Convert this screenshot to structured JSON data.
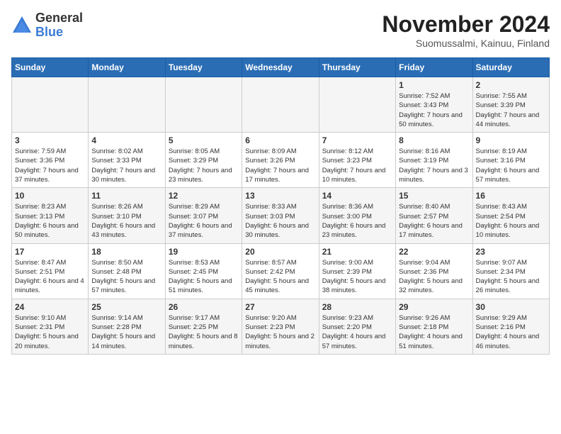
{
  "header": {
    "logo_general": "General",
    "logo_blue": "Blue",
    "month_title": "November 2024",
    "location": "Suomussalmi, Kainuu, Finland"
  },
  "weekdays": [
    "Sunday",
    "Monday",
    "Tuesday",
    "Wednesday",
    "Thursday",
    "Friday",
    "Saturday"
  ],
  "weeks": [
    [
      {
        "day": "",
        "info": ""
      },
      {
        "day": "",
        "info": ""
      },
      {
        "day": "",
        "info": ""
      },
      {
        "day": "",
        "info": ""
      },
      {
        "day": "",
        "info": ""
      },
      {
        "day": "1",
        "info": "Sunrise: 7:52 AM\nSunset: 3:43 PM\nDaylight: 7 hours\nand 50 minutes."
      },
      {
        "day": "2",
        "info": "Sunrise: 7:55 AM\nSunset: 3:39 PM\nDaylight: 7 hours\nand 44 minutes."
      }
    ],
    [
      {
        "day": "3",
        "info": "Sunrise: 7:59 AM\nSunset: 3:36 PM\nDaylight: 7 hours\nand 37 minutes."
      },
      {
        "day": "4",
        "info": "Sunrise: 8:02 AM\nSunset: 3:33 PM\nDaylight: 7 hours\nand 30 minutes."
      },
      {
        "day": "5",
        "info": "Sunrise: 8:05 AM\nSunset: 3:29 PM\nDaylight: 7 hours\nand 23 minutes."
      },
      {
        "day": "6",
        "info": "Sunrise: 8:09 AM\nSunset: 3:26 PM\nDaylight: 7 hours\nand 17 minutes."
      },
      {
        "day": "7",
        "info": "Sunrise: 8:12 AM\nSunset: 3:23 PM\nDaylight: 7 hours\nand 10 minutes."
      },
      {
        "day": "8",
        "info": "Sunrise: 8:16 AM\nSunset: 3:19 PM\nDaylight: 7 hours\nand 3 minutes."
      },
      {
        "day": "9",
        "info": "Sunrise: 8:19 AM\nSunset: 3:16 PM\nDaylight: 6 hours\nand 57 minutes."
      }
    ],
    [
      {
        "day": "10",
        "info": "Sunrise: 8:23 AM\nSunset: 3:13 PM\nDaylight: 6 hours\nand 50 minutes."
      },
      {
        "day": "11",
        "info": "Sunrise: 8:26 AM\nSunset: 3:10 PM\nDaylight: 6 hours\nand 43 minutes."
      },
      {
        "day": "12",
        "info": "Sunrise: 8:29 AM\nSunset: 3:07 PM\nDaylight: 6 hours\nand 37 minutes."
      },
      {
        "day": "13",
        "info": "Sunrise: 8:33 AM\nSunset: 3:03 PM\nDaylight: 6 hours\nand 30 minutes."
      },
      {
        "day": "14",
        "info": "Sunrise: 8:36 AM\nSunset: 3:00 PM\nDaylight: 6 hours\nand 23 minutes."
      },
      {
        "day": "15",
        "info": "Sunrise: 8:40 AM\nSunset: 2:57 PM\nDaylight: 6 hours\nand 17 minutes."
      },
      {
        "day": "16",
        "info": "Sunrise: 8:43 AM\nSunset: 2:54 PM\nDaylight: 6 hours\nand 10 minutes."
      }
    ],
    [
      {
        "day": "17",
        "info": "Sunrise: 8:47 AM\nSunset: 2:51 PM\nDaylight: 6 hours\nand 4 minutes."
      },
      {
        "day": "18",
        "info": "Sunrise: 8:50 AM\nSunset: 2:48 PM\nDaylight: 5 hours\nand 57 minutes."
      },
      {
        "day": "19",
        "info": "Sunrise: 8:53 AM\nSunset: 2:45 PM\nDaylight: 5 hours\nand 51 minutes."
      },
      {
        "day": "20",
        "info": "Sunrise: 8:57 AM\nSunset: 2:42 PM\nDaylight: 5 hours\nand 45 minutes."
      },
      {
        "day": "21",
        "info": "Sunrise: 9:00 AM\nSunset: 2:39 PM\nDaylight: 5 hours\nand 38 minutes."
      },
      {
        "day": "22",
        "info": "Sunrise: 9:04 AM\nSunset: 2:36 PM\nDaylight: 5 hours\nand 32 minutes."
      },
      {
        "day": "23",
        "info": "Sunrise: 9:07 AM\nSunset: 2:34 PM\nDaylight: 5 hours\nand 26 minutes."
      }
    ],
    [
      {
        "day": "24",
        "info": "Sunrise: 9:10 AM\nSunset: 2:31 PM\nDaylight: 5 hours\nand 20 minutes."
      },
      {
        "day": "25",
        "info": "Sunrise: 9:14 AM\nSunset: 2:28 PM\nDaylight: 5 hours\nand 14 minutes."
      },
      {
        "day": "26",
        "info": "Sunrise: 9:17 AM\nSunset: 2:25 PM\nDaylight: 5 hours\nand 8 minutes."
      },
      {
        "day": "27",
        "info": "Sunrise: 9:20 AM\nSunset: 2:23 PM\nDaylight: 5 hours\nand 2 minutes."
      },
      {
        "day": "28",
        "info": "Sunrise: 9:23 AM\nSunset: 2:20 PM\nDaylight: 4 hours\nand 57 minutes."
      },
      {
        "day": "29",
        "info": "Sunrise: 9:26 AM\nSunset: 2:18 PM\nDaylight: 4 hours\nand 51 minutes."
      },
      {
        "day": "30",
        "info": "Sunrise: 9:29 AM\nSunset: 2:16 PM\nDaylight: 4 hours\nand 46 minutes."
      }
    ]
  ]
}
